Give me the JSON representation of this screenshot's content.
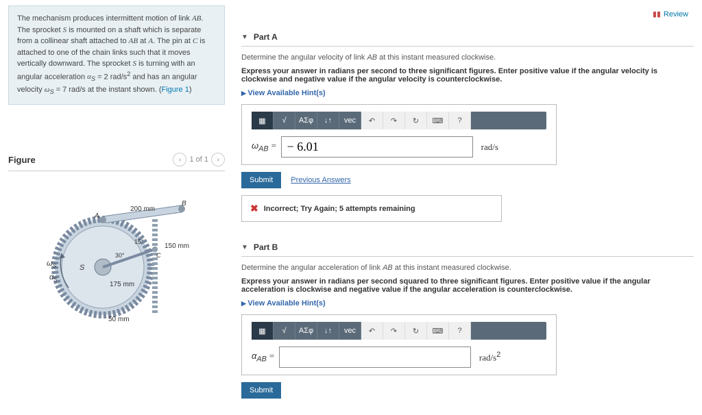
{
  "review": "Review",
  "problem": {
    "text_html": "The mechanism produces intermittent motion of link <i>AB</i>. The sprocket <i>S</i> is mounted on a shaft which is separate from a collinear shaft attached to <i>AB</i> at <i>A</i>. The pin at <i>C</i> is attached to one of the chain links such that it moves vertically downward. The sprocket <i>S</i> is turning with an angular acceleration α<sub>S</sub> = 2 rad/s² and has an angular velocity ω<sub>S</sub> = 7 rad/s at the instant shown. (Figure 1)"
  },
  "partA": {
    "title": "Part A",
    "instruct": "Determine the angular velocity of link AB at this instant measured clockwise.",
    "express": "Express your answer in radians per second to three significant figures. Enter positive value if the angular velocity is clockwise and negative value if the angular velocity is counterclockwise.",
    "hint": "View Available Hint(s)",
    "var": "ω_AB =",
    "value": "− 6.01",
    "unit": "rad/s",
    "submit": "Submit",
    "prev": "Previous Answers",
    "feedback": "Incorrect; Try Again; 5 attempts remaining"
  },
  "partB": {
    "title": "Part B",
    "instruct": "Determine the angular acceleration of link AB at this instant measured clockwise.",
    "express": "Express your answer in radians per second squared to three significant figures. Enter positive value if the angular acceleration is clockwise and negative value if the angular acceleration is counterclockwise.",
    "hint": "View Available Hint(s)",
    "var": "α_AB =",
    "value": "",
    "unit": "rad/s²",
    "submit": "Submit"
  },
  "figure": {
    "title": "Figure",
    "pager": "1 of 1",
    "labels": {
      "d200": "200 mm",
      "d150": "150 mm",
      "d175": "175 mm",
      "d50": "50 mm",
      "a15": "15°",
      "a30": "30°",
      "A": "A",
      "B": "B",
      "C": "C",
      "S": "S",
      "ws": "ω_S",
      "as": "α_S"
    }
  },
  "toolbar_icons": [
    "templates",
    "root",
    "sigma",
    "xexp",
    "vec",
    "undo",
    "redo",
    "reset",
    "keyboard",
    "help"
  ]
}
